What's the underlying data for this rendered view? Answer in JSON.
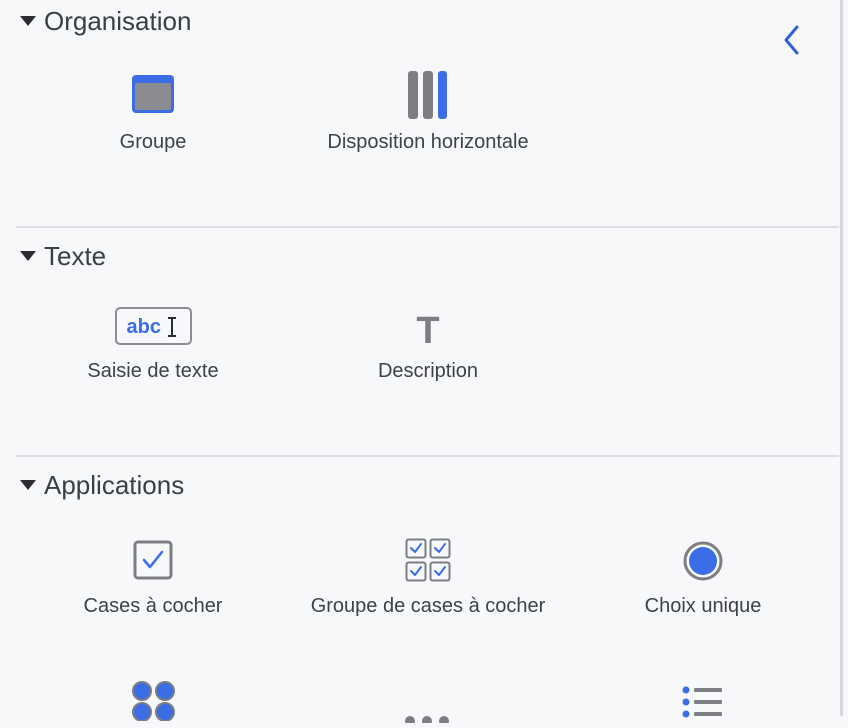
{
  "sections": [
    {
      "title": "Organisation",
      "items": [
        {
          "label": "Groupe",
          "icon": "group-icon"
        },
        {
          "label": "Disposition horizontale",
          "icon": "horizontal-layout-icon"
        }
      ]
    },
    {
      "title": "Texte",
      "items": [
        {
          "label": "Saisie de texte",
          "icon": "text-input-icon",
          "icon_text": "abc"
        },
        {
          "label": "Description",
          "icon": "description-icon",
          "icon_text": "T"
        }
      ]
    },
    {
      "title": "Applications",
      "items": [
        {
          "label": "Cases à cocher",
          "icon": "checkbox-icon"
        },
        {
          "label": "Groupe de cases à cocher",
          "icon": "checkbox-group-icon"
        },
        {
          "label": "Choix unique",
          "icon": "radio-icon"
        }
      ]
    }
  ],
  "colors": {
    "accent": "#3b6de6",
    "icon_gray": "#7c7e83",
    "background": "#f7f8fa",
    "divider": "#dcdee2"
  },
  "collapse_icon": "chevron-left-icon"
}
